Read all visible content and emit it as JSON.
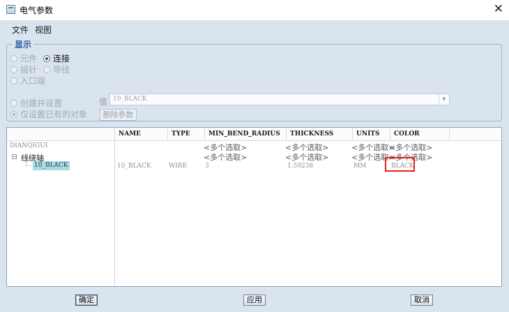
{
  "window": {
    "title": "电气参数",
    "close": "✕"
  },
  "menu": {
    "items": [
      "文件",
      "视图"
    ]
  },
  "display_group": {
    "legend": "显示",
    "options": {
      "component": "元件",
      "connection": "连接",
      "pin": "插针",
      "wire": "导线",
      "entry_port": "入口端"
    },
    "selected": "连接"
  },
  "mode": {
    "create_and_set": "创建并设置",
    "set_existing_only": "仅设置已有的对象",
    "selected": "仅设置已有的对象"
  },
  "value_field": {
    "label": "值",
    "value": "10_BLACK"
  },
  "delete_param_button": "删除参数",
  "table": {
    "headers": [
      "NAME",
      "TYPE",
      "MIN_BEND_RADIUS",
      "THICKNESS",
      "UNITS",
      "COLOR"
    ],
    "tree": {
      "root": "DIANQIGUI",
      "node": "线绕轴",
      "leaf": "10_BLACK"
    },
    "rows": [
      {
        "name": "",
        "type": "",
        "min_bend_radius": "<多个选取>",
        "thickness": "<多个选取>",
        "units": "<多个选取>",
        "color": "<多个选取>"
      },
      {
        "name": "",
        "type": "",
        "min_bend_radius": "<多个选取>",
        "thickness": "<多个选取>",
        "units": "<多个选取>",
        "color": "<多个选取>"
      },
      {
        "name": "10_BLACK",
        "type": "WIRE",
        "min_bend_radius": "3",
        "thickness": "1.59238",
        "units": "MM",
        "color": "BLACK"
      }
    ]
  },
  "buttons": {
    "ok": "确定",
    "apply": "应用",
    "cancel": "取消"
  },
  "colors": {
    "highlight_box": "#e02020",
    "tree_selection": "#a9dbe2",
    "legend_text": "#2c58a5"
  }
}
